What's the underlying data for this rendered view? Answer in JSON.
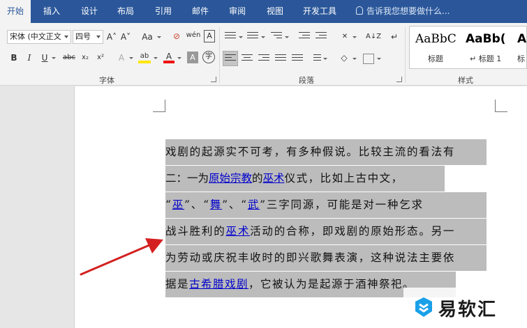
{
  "tabs": [
    "开始",
    "插入",
    "设计",
    "布局",
    "引用",
    "邮件",
    "审阅",
    "视图",
    "开发工具"
  ],
  "tell_me": "告诉我您想要做什么...",
  "ribbon": {
    "font_name": "宋体 (中文正文",
    "font_size": "四号",
    "grow": "A˄",
    "shrink": "A˅",
    "change_case": "Aa",
    "clear_format": "⊘",
    "phonetic": "wén",
    "char_border": "A",
    "bold": "B",
    "italic": "I",
    "underline": "U",
    "strike": "abc",
    "subscript": "x₂",
    "superscript": "x²",
    "text_effect": "A",
    "highlight": "ab",
    "font_color": "A",
    "char_shade": "A",
    "enclose": "字",
    "font_group": "字体",
    "para_group": "段落",
    "style_group": "样式",
    "sort": "A↓Z",
    "marks": "↵"
  },
  "styles": [
    {
      "sample": "AaBbC",
      "name": "标题"
    },
    {
      "sample": "AaBb(",
      "name": "↵ 标题 1"
    },
    {
      "sample": "A",
      "name": "标"
    }
  ],
  "document": {
    "line1": "戏剧的起源实不可考，有多种假说。比较主流的看法有",
    "line2_a": "二：一为",
    "line2_link1": "原始宗教",
    "line2_b": "的",
    "line2_link2": "巫术",
    "line2_c": "仪式，比如上古中文，",
    "line3_a": "“",
    "line3_link1": "巫",
    "line3_b": "”、“",
    "line3_link2": "舞",
    "line3_c": "”、“",
    "line3_link3": "武",
    "line3_d": "”三字同源，可能是对一种乞求",
    "line4_a": "战斗胜利的",
    "line4_link": "巫术",
    "line4_b": "活动的合称，即戏剧的原始形态。另一",
    "line5": "为劳动或庆祝丰收时的即兴歌舞表演，这种说法主要依",
    "line6_a": "据是",
    "line6_link": "古希腊戏剧",
    "line6_b": "，它被认为是起源于酒神祭祀。"
  },
  "watermark": "易软汇",
  "colors": {
    "tab_bar": "#2b579a",
    "selection": "#bcbcbc",
    "link": "#0000cc",
    "arrow": "#d42020"
  }
}
